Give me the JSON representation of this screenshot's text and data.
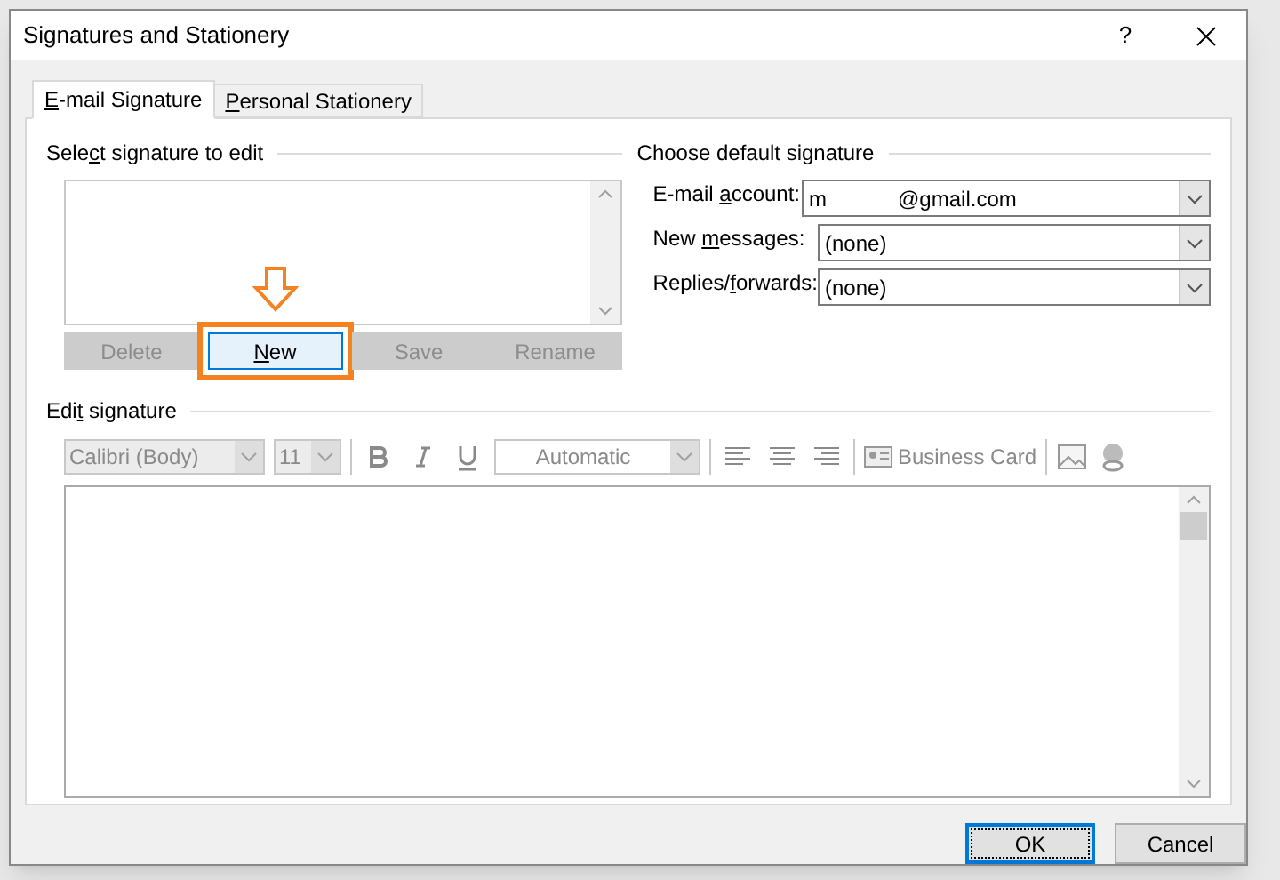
{
  "window": {
    "title": "Signatures and Stationery",
    "help": "?"
  },
  "tabs": [
    {
      "label": "E-mail Signature",
      "selected": true
    },
    {
      "label": "Personal Stationery",
      "selected": false
    }
  ],
  "select_signature": {
    "title": "Select signature to edit",
    "buttons": [
      {
        "label": "Delete",
        "disabled": true,
        "highlighted": false
      },
      {
        "label": "New",
        "disabled": false,
        "highlighted": true
      },
      {
        "label": "Save",
        "disabled": true,
        "highlighted": false
      },
      {
        "label": "Rename",
        "disabled": true,
        "highlighted": false
      }
    ]
  },
  "default_signature": {
    "title": "Choose default signature",
    "fields": [
      {
        "label": "E-mail account:",
        "value": "m            @gmail.com"
      },
      {
        "label": "New messages:",
        "value": "(none)"
      },
      {
        "label": "Replies/forwards:",
        "value": "(none)"
      }
    ]
  },
  "edit_signature": {
    "title": "Edit signature",
    "toolbar": {
      "font": "Calibri (Body)",
      "size": "11",
      "font_color_label": "Automatic",
      "business_card": "Business Card",
      "disabled": true
    }
  },
  "footer": {
    "buttons": [
      {
        "label": "OK",
        "default": true
      },
      {
        "label": "Cancel",
        "default": false
      }
    ]
  }
}
